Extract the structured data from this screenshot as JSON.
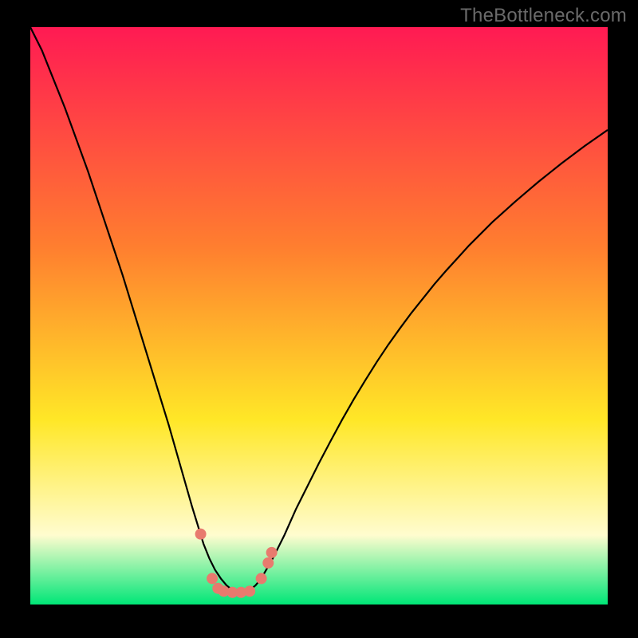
{
  "watermark": "TheBottleneck.com",
  "colors": {
    "gradient_top": "#ff1a53",
    "gradient_mid1": "#ff7e2f",
    "gradient_mid2": "#ffe727",
    "gradient_mid3": "#fffccf",
    "gradient_bottom": "#00e677",
    "curve": "#000000",
    "markers": "#e87a6e",
    "frame": "#000000"
  },
  "chart_data": {
    "type": "line",
    "title": "",
    "xlabel": "",
    "ylabel": "",
    "xlim": [
      0,
      100
    ],
    "ylim": [
      0,
      100
    ],
    "curve": {
      "name": "bottleneck-curve",
      "x": [
        0,
        2,
        4,
        6,
        8,
        10,
        12,
        14,
        16,
        18,
        20,
        22,
        24,
        26,
        28,
        30,
        31,
        32,
        33,
        34,
        35,
        36,
        37,
        38,
        39,
        40,
        42,
        44,
        46,
        48,
        50,
        52,
        54,
        56,
        58,
        60,
        62,
        64,
        66,
        68,
        70,
        72,
        74,
        76,
        78,
        80,
        82,
        84,
        86,
        88,
        90,
        92,
        94,
        96,
        98,
        100
      ],
      "y": [
        100,
        96,
        91,
        86,
        80.5,
        75,
        69,
        63,
        57,
        50.5,
        44,
        37.5,
        31,
        24,
        17,
        10.5,
        8,
        6,
        4.5,
        3.3,
        2.5,
        2.1,
        2.1,
        2.5,
        3.3,
        4.5,
        8,
        12,
        16.5,
        20.5,
        24.5,
        28.3,
        32,
        35.5,
        38.8,
        42,
        45,
        47.8,
        50.5,
        53,
        55.5,
        57.8,
        60,
        62.2,
        64.2,
        66.2,
        68,
        69.8,
        71.5,
        73.2,
        74.8,
        76.4,
        77.9,
        79.4,
        80.8,
        82.2
      ]
    },
    "markers": {
      "name": "data-points",
      "x": [
        29.5,
        31.5,
        32.5,
        33.5,
        35.0,
        36.5,
        38.0,
        40.0,
        41.2,
        41.8
      ],
      "y": [
        12.2,
        4.5,
        2.8,
        2.3,
        2.1,
        2.1,
        2.3,
        4.5,
        7.2,
        9.0
      ]
    }
  }
}
